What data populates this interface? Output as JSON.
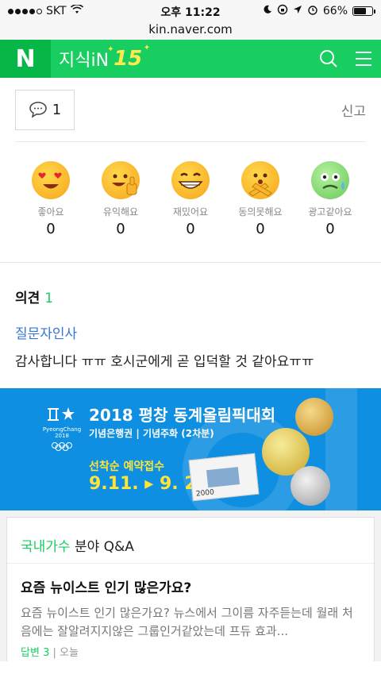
{
  "status_bar": {
    "carrier": "SKT",
    "time": "오후 11:22",
    "battery": "66%",
    "battery_level": 0.66
  },
  "url": "kin.naver.com",
  "header": {
    "logo": "N",
    "title": "지식iN",
    "badge": "15"
  },
  "comment_button": {
    "count": "1"
  },
  "report_label": "신고",
  "reactions": [
    {
      "label": "좋아요",
      "count": "0"
    },
    {
      "label": "유익해요",
      "count": "0"
    },
    {
      "label": "재밌어요",
      "count": "0"
    },
    {
      "label": "동의못해요",
      "count": "0"
    },
    {
      "label": "광고같아요",
      "count": "0"
    }
  ],
  "opinion": {
    "title": "의견",
    "count": "1",
    "user": "질문자인사",
    "text": "감사합니다 ㅠㅠ 호시군에게 곧 입덕할 것 같아요ㅠㅠ"
  },
  "banner": {
    "logo_text": "PyeongChang 2018",
    "title": "2018 평창 동계올림픽대회",
    "subtitle": "기념은행권 | 기념주화 (2차분)",
    "preorder": "선착순 예약접수",
    "dates": "9.11. ▸ 9. 29.",
    "note_value": "2000"
  },
  "qa": {
    "category": "국내가수",
    "suffix": "분야 Q&A",
    "question": "요즘 뉴이스트 인기 많은가요?",
    "desc": "요즘 뉴이스트 인기 많은가요? 뉴스에서 그이름 자주듣는데 월래 처음에는 잘알려지지않은 그룹인거같았는데 프듀 효과...",
    "answer_label": "답변",
    "answer_count": "3",
    "time": "오늘"
  }
}
